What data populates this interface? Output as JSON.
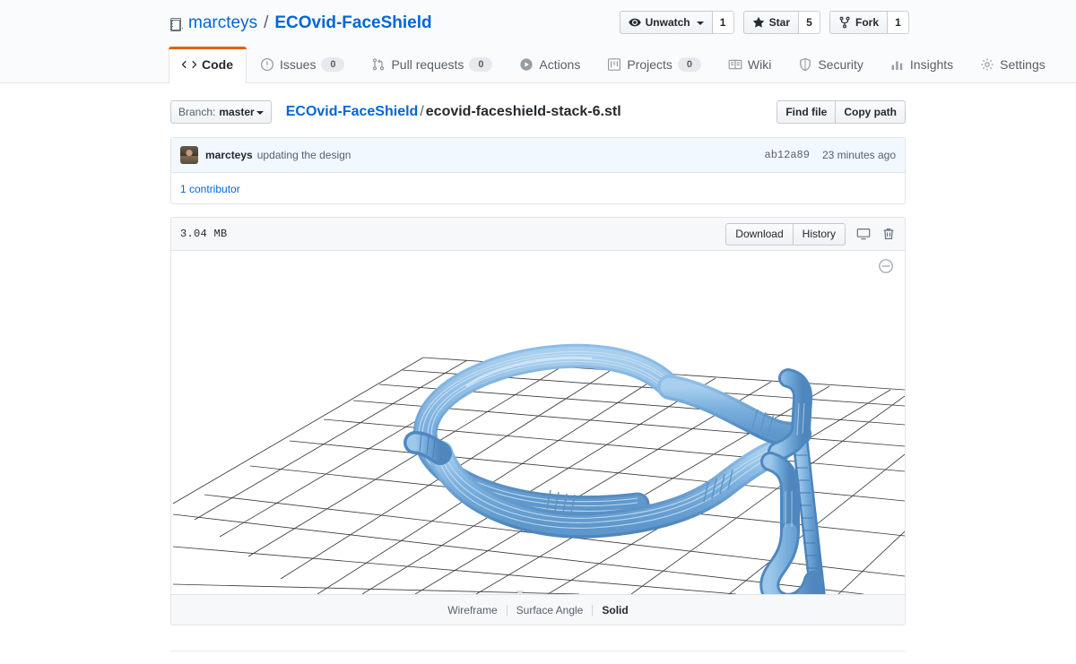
{
  "header": {
    "owner": "marcteys",
    "separator": "/",
    "repo_name": "ECOvid-FaceShield",
    "repo_icon": "repo-icon",
    "social": [
      {
        "icon": "eye-icon",
        "label": "Unwatch",
        "count": "1",
        "has_caret": true
      },
      {
        "icon": "star-icon",
        "label": "Star",
        "count": "5",
        "has_caret": false
      },
      {
        "icon": "fork-icon",
        "label": "Fork",
        "count": "1",
        "has_caret": false
      }
    ],
    "tabs": [
      {
        "label": "Code",
        "icon": "code-icon",
        "count": null,
        "active": true
      },
      {
        "label": "Issues",
        "icon": "issue-icon",
        "count": "0",
        "active": false
      },
      {
        "label": "Pull requests",
        "icon": "pr-icon",
        "count": "0",
        "active": false
      },
      {
        "label": "Actions",
        "icon": "play-icon",
        "count": null,
        "active": false
      },
      {
        "label": "Projects",
        "icon": "project-icon",
        "count": "0",
        "active": false
      },
      {
        "label": "Wiki",
        "icon": "book-icon",
        "count": null,
        "active": false
      },
      {
        "label": "Security",
        "icon": "shield-icon",
        "count": null,
        "active": false
      },
      {
        "label": "Insights",
        "icon": "graph-icon",
        "count": null,
        "active": false
      },
      {
        "label": "Settings",
        "icon": "gear-icon",
        "count": null,
        "active": false
      }
    ]
  },
  "file_nav": {
    "branch_label": "Branch:",
    "branch_value": "master",
    "breadcrumb_root": "ECOvid-FaceShield",
    "breadcrumb_sep": "/",
    "breadcrumb_file": "ecovid-faceshield-stack-6.stl",
    "find_file": "Find file",
    "copy_path": "Copy path"
  },
  "commit": {
    "author": "marcteys",
    "message": "updating the design",
    "sha": "ab12a89",
    "time": "23 minutes ago",
    "contributors": "1 contributor"
  },
  "file": {
    "size": "3.04 MB",
    "download": "Download",
    "history": "History",
    "open_desktop_icon": "device-desktop-icon",
    "delete_icon": "trash-icon",
    "zoom_out_icon": "zoom-out-icon"
  },
  "viewer": {
    "render_modes": [
      {
        "label": "Wireframe",
        "active": false
      },
      {
        "label": "Surface Angle",
        "active": false
      },
      {
        "label": "Solid",
        "active": true
      }
    ],
    "model_color": "#6fa8dc",
    "model_color_dark": "#4a87c4",
    "model_color_light": "#9cc7ea",
    "grid_color": "#333333",
    "background": "#ffffff"
  },
  "colors": {
    "accent": "#0366d6",
    "active_tab_border": "#e36209",
    "header_bg": "#fafbfc",
    "border": "#e1e4e8",
    "muted_text": "#586069",
    "commit_bg": "#f1f8ff"
  }
}
